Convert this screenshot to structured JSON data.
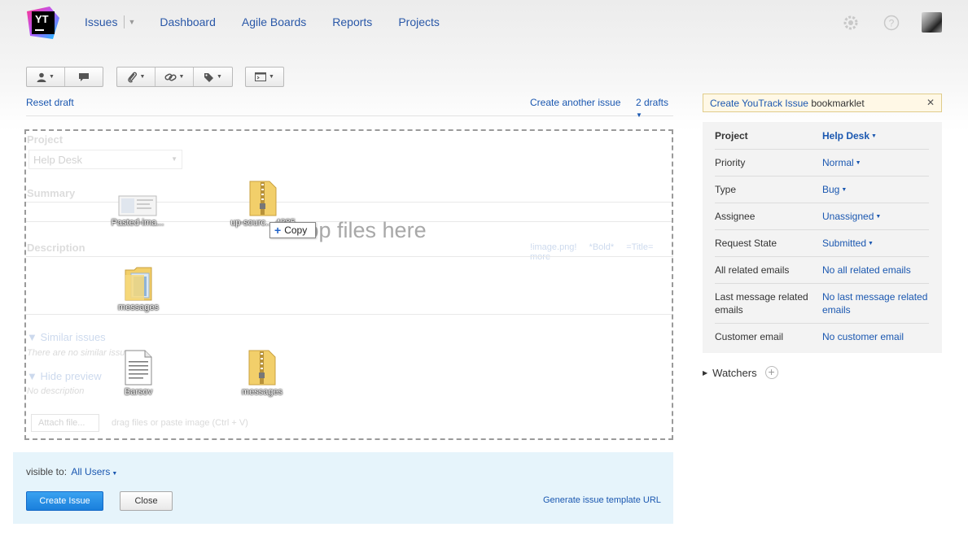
{
  "app": {
    "logo_text": "YT"
  },
  "nav": {
    "items": [
      {
        "label": "Issues"
      },
      {
        "label": "Dashboard"
      },
      {
        "label": "Agile Boards"
      },
      {
        "label": "Reports"
      },
      {
        "label": "Projects"
      }
    ]
  },
  "draft": {
    "reset_label": "Reset draft",
    "create_another_label": "Create another issue",
    "drafts_label": "2 drafts"
  },
  "form": {
    "project_label": "Project",
    "project_value": "Help Desk",
    "summary_label": "Summary",
    "description_label": "Description",
    "markup_hints": [
      "!image.png!",
      "*Bold*",
      "=Title=",
      "more"
    ],
    "similar_issues_label": "Similar issues",
    "similar_issues_empty": "There are no similar issues",
    "hide_preview_label": "Hide preview",
    "no_description": "No description",
    "attach_label": "Attach file...",
    "drag_hint": "drag files or paste image (Ctrl + V)"
  },
  "dropzone": {
    "text": "Drop files here",
    "copy_label": "Copy",
    "files": [
      {
        "name": "Pasted-ima...",
        "type": "image"
      },
      {
        "name": "up-sourc... 4385",
        "type": "zip"
      },
      {
        "name": "messages",
        "type": "folder"
      },
      {
        "name": "Barsov",
        "type": "text"
      },
      {
        "name": "messages",
        "type": "zip"
      }
    ]
  },
  "bottom": {
    "visible_to_label": "visible to:",
    "visible_to_value": "All Users",
    "create_button": "Create Issue",
    "close_button": "Close",
    "template_url_link": "Generate issue template URL"
  },
  "sidebar": {
    "bookmarklet_link": "Create YouTrack Issue",
    "bookmarklet_suffix": "bookmarklet",
    "fields": [
      {
        "label": "Project",
        "value": "Help Desk"
      },
      {
        "label": "Priority",
        "value": "Normal"
      },
      {
        "label": "Type",
        "value": "Bug"
      },
      {
        "label": "Assignee",
        "value": "Unassigned"
      },
      {
        "label": "Request State",
        "value": "Submitted"
      },
      {
        "label": "All related emails",
        "value": "No all related emails"
      },
      {
        "label": "Last message related emails",
        "value": "No last message related emails"
      },
      {
        "label": "Customer email",
        "value": "No customer email"
      }
    ],
    "watchers_label": "Watchers"
  },
  "colors": {
    "accent": "#1a57b0",
    "primary_button": "#1a7fdc",
    "bottom_panel": "#e6f4fb",
    "bookmarklet_bg": "#fff8e6"
  }
}
